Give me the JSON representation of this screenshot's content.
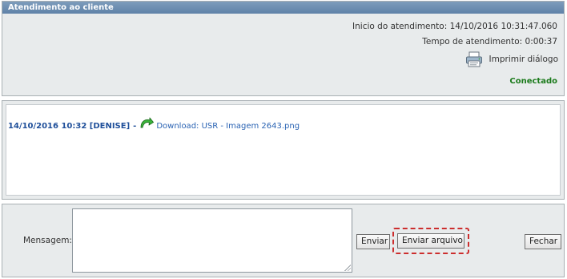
{
  "info": {
    "header_title": "Atendimento ao cliente",
    "start_label": "Inicio do atendimento:",
    "start_value": "14/10/2016 10:31:47.060",
    "duration_label": "Tempo de atendimento:",
    "duration_value": "0:00:37",
    "print_label": "Imprimir diálogo",
    "print_icon": "printer-icon",
    "status": "Conectado",
    "status_color": "#1a7a1a"
  },
  "chat": {
    "messages": [
      {
        "meta": "14/10/2016 10:32 [DENISE]",
        "separator": "-",
        "icon": "green-arrow-download-icon",
        "link_text": "Download: USR - Imagem 2643.png"
      }
    ]
  },
  "compose": {
    "message_label": "Mensagem:",
    "message_value": "",
    "send_label": "Enviar",
    "send_file_label": "Enviar arquivo",
    "close_label": "Fechar",
    "highlight_color": "#cc2e2e"
  }
}
